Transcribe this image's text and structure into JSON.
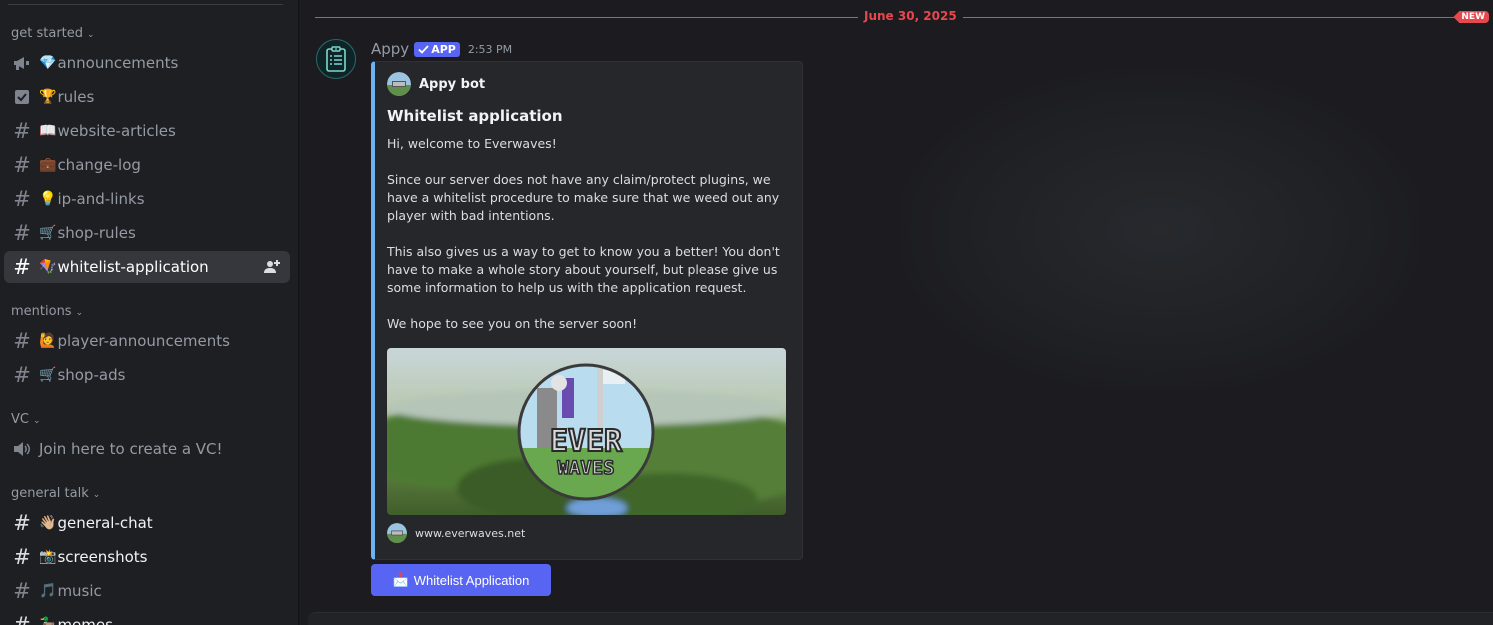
{
  "sidebar": {
    "categories": [
      {
        "label": "get started"
      },
      {
        "label": "mentions"
      },
      {
        "label": "VC"
      },
      {
        "label": "general talk"
      }
    ],
    "channels": [
      {
        "emoji": "💎",
        "name": "announcements",
        "icon": "megaphone-icon"
      },
      {
        "emoji": "🏆",
        "name": "rules",
        "icon": "checkbox-icon"
      },
      {
        "emoji": "📖",
        "name": "website-articles",
        "icon": "hash-icon"
      },
      {
        "emoji": "💼",
        "name": "change-log",
        "icon": "hash-icon"
      },
      {
        "emoji": "💡",
        "name": "ip-and-links",
        "icon": "hash-icon"
      },
      {
        "emoji": "🛒",
        "name": "shop-rules",
        "icon": "hash-icon"
      },
      {
        "emoji": "🪁",
        "name": "whitelist-application",
        "icon": "hash-icon",
        "active": true
      },
      {
        "emoji": "🙋",
        "name": "player-announcements",
        "icon": "hash-icon"
      },
      {
        "emoji": "🛒",
        "name": "shop-ads",
        "icon": "hash-icon"
      },
      {
        "emoji": "",
        "name": "Join here to create a VC!",
        "icon": "speaker-icon"
      },
      {
        "emoji": "👋🏼",
        "name": "general-chat",
        "icon": "hash-icon",
        "unread": true
      },
      {
        "emoji": "📸",
        "name": "screenshots",
        "icon": "hash-icon",
        "unread": true
      },
      {
        "emoji": "🎵",
        "name": "music",
        "icon": "hash-icon"
      },
      {
        "emoji": "🦆",
        "name": "memes",
        "icon": "hash-icon",
        "unread": true
      }
    ]
  },
  "main": {
    "divider_date": "June 30, 2025",
    "new_badge": "NEW",
    "message": {
      "author": "Appy",
      "app_tag": "APP",
      "time": "2:53 PM",
      "embed": {
        "author": "Appy bot",
        "title": "Whitelist application",
        "paragraphs": [
          "Hi, welcome to Everwaves!",
          "Since our server does not have any claim/protect plugins, we have a whitelist procedure to make sure that we weed out any player with bad intentions.",
          "This also gives us a way to get to know you a better! You don't have to make a whole story about yourself, but please give us some information to help us with the application request.",
          "We hope to see you on the server soon!"
        ],
        "image_text_top": "EVER",
        "image_text_bottom": "WAVES",
        "footer": "www.everwaves.net",
        "accent_color": "#6eb2f2"
      },
      "button": {
        "emoji": "📩",
        "label": "Whitelist Application"
      }
    }
  },
  "colors": {
    "accent": "#5865f2",
    "new_divider": "#e5484d"
  }
}
